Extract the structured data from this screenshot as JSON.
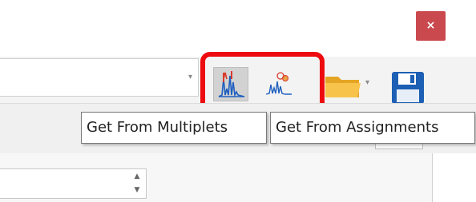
{
  "window": {
    "close_label": "×"
  },
  "toolbar": {
    "combo_arrow": "▾",
    "folder_arrow": "▾",
    "icons": {
      "get_from_multiplets": "spectrum-multiplets-icon",
      "get_from_assignments": "spectrum-assignments-icon",
      "open_folder": "folder-icon",
      "save": "floppy-disk-icon"
    },
    "highlight_color": "#ee0b0f"
  },
  "tooltips": {
    "multiplets": "Get From Multiplets",
    "assignments": "Get From Assignments"
  },
  "spinbox": {
    "up": "▲",
    "down": "▼"
  }
}
